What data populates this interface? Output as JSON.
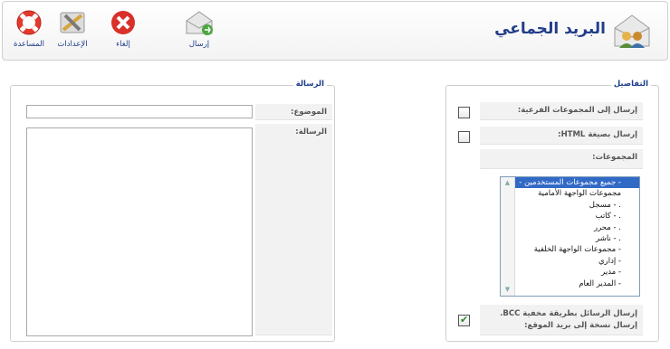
{
  "toolbar": {
    "title": "البريد الجماعي",
    "buttons": [
      {
        "label": "المساعدة",
        "icon": "help-lifebuoy-icon"
      },
      {
        "label": "الإعدادات",
        "icon": "settings-tools-icon"
      },
      {
        "label": "إلغاء",
        "icon": "cancel-icon"
      },
      {
        "label": "إرسال",
        "icon": "send-mail-icon"
      }
    ]
  },
  "details": {
    "legend": "التفاصيل",
    "send_to_subgroups_label": "إرسال إلى المجموعات الفرعية:",
    "send_to_subgroups_checked": false,
    "send_html_label": "إرسال بصيغة HTML:",
    "send_html_checked": false,
    "groups_label": "المجموعات:",
    "groups": [
      "- جميع مجموعات المستخدمين -",
      "مجموعات الواجهة الأمامية",
      ". - مسجل",
      ". - كاتب",
      ". - محرر",
      ". - ناشر",
      "- مجموعات الواجهة الخلفية",
      "- إداري",
      "- مدير",
      "- المدير العام"
    ],
    "groups_selected_index": 0,
    "bcc_label_line1": "إرسال الرسائل بطريقة مخفية BCC.",
    "bcc_label_line2": "إرسال نسخة إلى بريد الموقع:",
    "bcc_checked": true
  },
  "message": {
    "legend": "الرسالة",
    "subject_label": "الموضوع:",
    "subject_value": "",
    "body_label": "الرسالة:",
    "body_value": ""
  }
}
